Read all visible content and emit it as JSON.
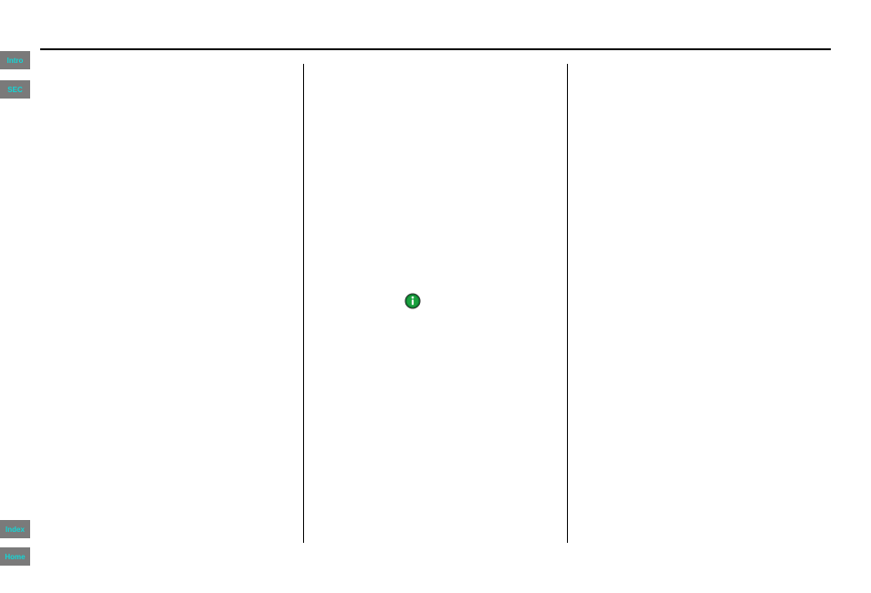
{
  "nav": {
    "intro": "Intro",
    "sec": "SEC",
    "index": "Index",
    "home": "Home"
  },
  "icons": {
    "info": "info-icon"
  }
}
